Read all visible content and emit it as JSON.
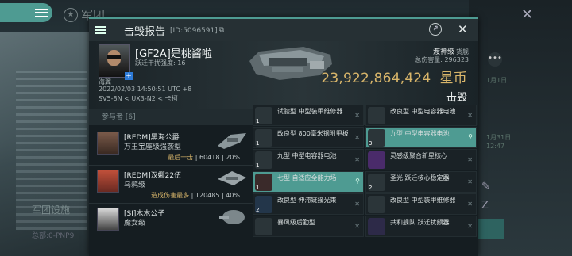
{
  "background": {
    "legion_label": "军团",
    "side_label": "军团设施",
    "bottom_label": "总部:0-PNP9",
    "right_texts": [
      "1月1日",
      "1月31日",
      "12:47"
    ]
  },
  "panel": {
    "title": "击毁报告",
    "report_id": "[ID:5096591]",
    "copy_glyph": "⧉"
  },
  "victim": {
    "name": "[GF2A]是桃酱啦",
    "security_label": "跃迁干扰强度: 16",
    "corp": "海翼",
    "datetime": "2022/02/03 14:50:51 UTC +8",
    "location": "SV5-8N < UX3-N2 < 卡柯",
    "ship_name": "渡神级",
    "ship_class": "货舰",
    "total_value_label": "总伤害量: 296323",
    "isk_value": "23,922,864,424",
    "isk_unit": "星币",
    "kill_label": "击毁"
  },
  "participants": {
    "header": "参与者 [6]",
    "items": [
      {
        "name": "[REDM]黑海公爵",
        "ship": "万王宝座级强袭型",
        "stat_label": "最后一击",
        "damage": "60418",
        "percent": "20%",
        "avatar_color": "#6b4a3a"
      },
      {
        "name": "[REDM]汉娜22伍",
        "ship": "乌鸦级",
        "stat_label": "造成伤害最多",
        "damage": "120485",
        "percent": "40%",
        "avatar_color": "#a03a2a"
      },
      {
        "name": "[SI]木木公子",
        "ship": "魔女级",
        "stat_label": "",
        "damage": "",
        "percent": "",
        "avatar_color": "#3a3a3a"
      }
    ]
  },
  "items": [
    {
      "label": "试验型 中型装甲维修器",
      "qty": "1",
      "highlight": false,
      "dropped": false
    },
    {
      "label": "改良型 中型电容器电池",
      "qty": "",
      "highlight": false,
      "dropped": false
    },
    {
      "label": "改良型 800毫米钢附甲板",
      "qty": "1",
      "highlight": false,
      "dropped": false
    },
    {
      "label": "九型 中型电容器电池",
      "qty": "3",
      "highlight": true,
      "dropped": true
    },
    {
      "label": "九型 中型电容器电池",
      "qty": "1",
      "highlight": false,
      "dropped": false
    },
    {
      "label": "灵感级聚合新星核心",
      "qty": "",
      "highlight": false,
      "dropped": false
    },
    {
      "label": "七型 自适应全能力场",
      "qty": "1",
      "highlight": true,
      "dropped": true
    },
    {
      "label": "圣光 跃迁核心稳定器",
      "qty": "2",
      "highlight": false,
      "dropped": false
    },
    {
      "label": "改良型 伸滞链接光束",
      "qty": "2",
      "highlight": false,
      "dropped": false
    },
    {
      "label": "改良型 中型装甲维修器",
      "qty": "",
      "highlight": false,
      "dropped": false
    },
    {
      "label": "暴风级后勤型",
      "qty": "",
      "highlight": false,
      "dropped": false
    },
    {
      "label": "共和舰队 跃迁扰频器",
      "qty": "",
      "highlight": false,
      "dropped": false
    }
  ],
  "icons": {
    "close": "✕",
    "drop_marker": "✕",
    "pin": "⚲",
    "share": "⇗"
  }
}
